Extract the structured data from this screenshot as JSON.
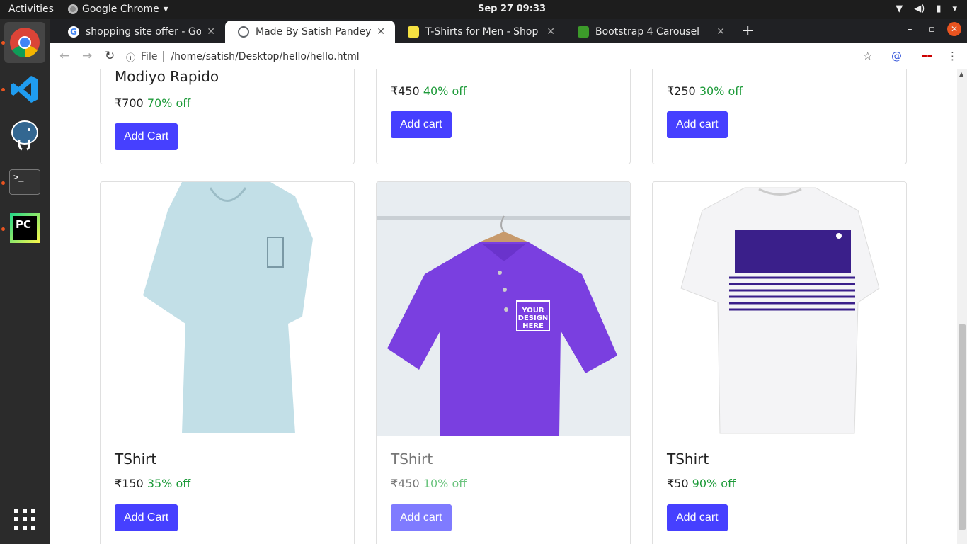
{
  "topbar": {
    "activities": "Activities",
    "app_name": "Google Chrome",
    "clock": "Sep 27  09:33"
  },
  "tabs": [
    {
      "label": "shopping site offer - Goog",
      "favicon_color": "#4285f4"
    },
    {
      "label": "Made By Satish Pandey",
      "favicon_color": "#5f6368"
    },
    {
      "label": "T-Shirts for Men - Shop fo",
      "favicon_color": "#f5e142"
    },
    {
      "label": "Bootstrap 4 Carousel",
      "favicon_color": "#3c9a2a"
    }
  ],
  "toolbar": {
    "file_label": "File",
    "url": "/home/satish/Desktop/hello/hello.html"
  },
  "products_top": [
    {
      "title": "Modiyo Rapido",
      "price": "₹700",
      "discount": "70% off",
      "button": "Add Cart"
    },
    {
      "title": "",
      "price": "₹450",
      "discount": "40% off",
      "button": "Add cart"
    },
    {
      "title": "",
      "price": "₹250",
      "discount": "30% off",
      "button": "Add cart"
    }
  ],
  "products_bottom": [
    {
      "title": "TShirt",
      "price": "₹150",
      "discount": "35% off",
      "button": "Add Cart",
      "shirt_color": "#bfdde6"
    },
    {
      "title": "TShirt",
      "price": "₹450",
      "discount": "10% off",
      "button": "Add cart",
      "shirt_color": "#7a3fe0",
      "print_text": "YOUR DESIGN HERE"
    },
    {
      "title": "TShirt",
      "price": "₹50",
      "discount": "90% off",
      "button": "Add cart",
      "shirt_color": "#ffffff",
      "stripe_color": "#3a1f8a"
    }
  ],
  "colors": {
    "button": "#4640ff",
    "discount": "#1e9b3a"
  }
}
